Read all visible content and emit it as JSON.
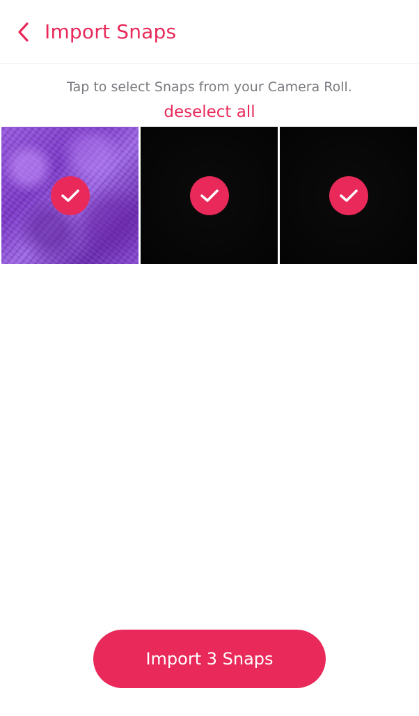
{
  "header": {
    "title": "Import Snaps",
    "back_icon": "chevron-left-icon"
  },
  "instruction": "Tap to select Snaps from your Camera Roll.",
  "deselect_label": "deselect all",
  "photos": [
    {
      "selected": true,
      "style": "purple"
    },
    {
      "selected": true,
      "style": "dark"
    },
    {
      "selected": true,
      "style": "dark"
    }
  ],
  "import_button_label": "Import 3 Snaps",
  "colors": {
    "accent": "#e8295a",
    "instruction_text": "#7a7a80",
    "background": "#ffffff"
  }
}
